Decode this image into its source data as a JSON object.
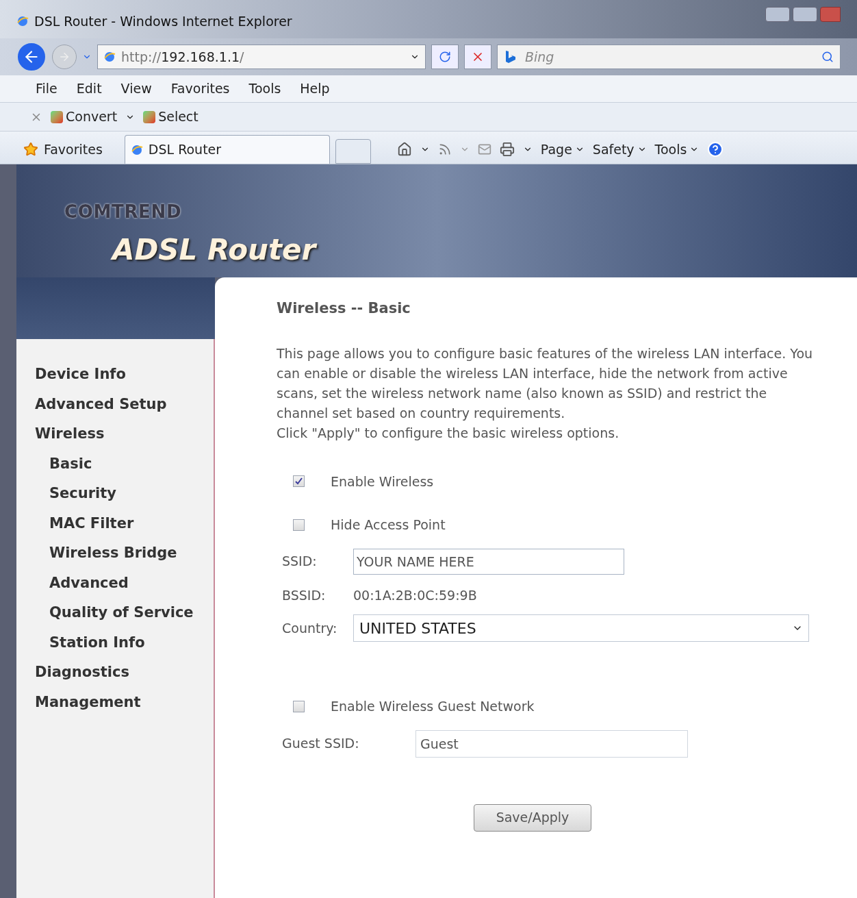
{
  "window": {
    "title": "DSL Router - Windows Internet Explorer"
  },
  "address_bar": {
    "url_prefix": "http://",
    "url_host": "192.168.1.1",
    "url_suffix": "/"
  },
  "search": {
    "placeholder": "Bing"
  },
  "menu": [
    "File",
    "Edit",
    "View",
    "Favorites",
    "Tools",
    "Help"
  ],
  "addon_bar": [
    {
      "label": "Convert"
    },
    {
      "label": "Select"
    }
  ],
  "favorites": {
    "label": "Favorites"
  },
  "tabs": [
    {
      "label": "DSL Router",
      "selected": true
    }
  ],
  "command_bar": [
    "Page",
    "Safety",
    "Tools"
  ],
  "banner": {
    "brand": "COMTREND",
    "product": "ADSL Router"
  },
  "sidebar": {
    "items": [
      {
        "label": "Device Info"
      },
      {
        "label": "Advanced Setup"
      },
      {
        "label": "Wireless",
        "children": [
          {
            "label": "Basic"
          },
          {
            "label": "Security"
          },
          {
            "label": "MAC Filter"
          },
          {
            "label": "Wireless Bridge"
          },
          {
            "label": "Advanced"
          },
          {
            "label": "Quality of Service"
          },
          {
            "label": "Station Info"
          }
        ]
      },
      {
        "label": "Diagnostics"
      },
      {
        "label": "Management"
      }
    ]
  },
  "content": {
    "title": "Wireless -- Basic",
    "description": "This page allows you to configure basic features of the wireless LAN interface. You can enable or disable the wireless LAN interface, hide the network from active scans, set the wireless network name (also known as SSID) and restrict the channel set based on country requirements.",
    "instruction": "Click \"Apply\" to configure the basic wireless options.",
    "enable_wireless": {
      "label": "Enable Wireless",
      "checked": true
    },
    "hide_access_point": {
      "label": "Hide Access Point",
      "checked": false
    },
    "ssid": {
      "label": "SSID:",
      "value": "YOUR NAME HERE"
    },
    "bssid": {
      "label": "BSSID:",
      "value": "00:1A:2B:0C:59:9B"
    },
    "country": {
      "label": "Country:",
      "value": "UNITED STATES"
    },
    "guest_network": {
      "label": "Enable Wireless Guest Network",
      "checked": false
    },
    "guest_ssid": {
      "label": "Guest SSID:",
      "value": "Guest"
    },
    "save_button": "Save/Apply"
  }
}
